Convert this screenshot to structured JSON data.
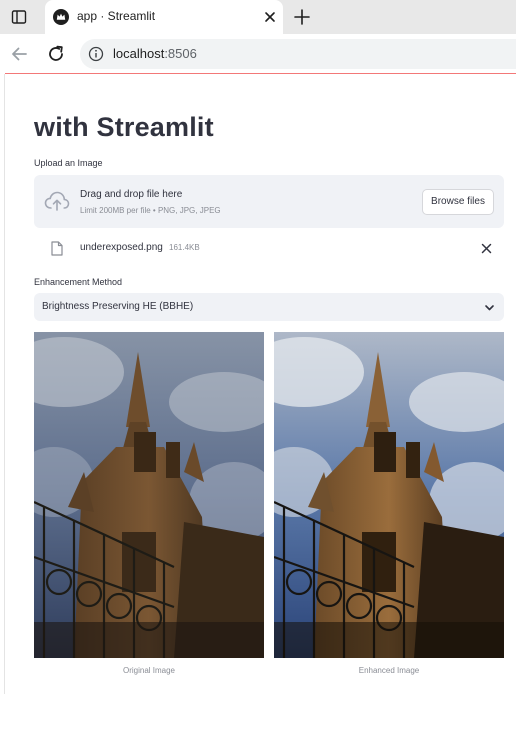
{
  "browser": {
    "tab_title": "app · Streamlit",
    "url_host": "localhost",
    "url_port": ":8506"
  },
  "app": {
    "title": "with Streamlit",
    "uploader": {
      "label": "Upload an Image",
      "dropzone_title": "Drag and drop file here",
      "dropzone_limit": "Limit 200MB per file • PNG, JPG, JPEG",
      "browse_label": "Browse files",
      "file_name": "underexposed.png",
      "file_size": "161.4KB"
    },
    "method": {
      "label": "Enhancement Method",
      "selected": "Brightness Preserving HE (BBHE)"
    },
    "images": {
      "original_caption": "Original Image",
      "enhanced_caption": "Enhanced Image"
    }
  },
  "icons": {
    "tab_panel": "sidebar-panel-icon",
    "favicon": "streamlit-crown-icon",
    "close": "close-icon",
    "new_tab": "plus-icon",
    "back": "arrow-left-icon",
    "reload": "reload-icon",
    "site_info": "info-icon",
    "upload": "cloud-upload-icon",
    "file": "file-icon",
    "remove": "close-icon",
    "chevron": "chevron-down-icon"
  },
  "colors": {
    "accent": "#ef4b4b",
    "widget_bg": "#f0f2f6",
    "text": "#31333f",
    "muted": "#8a8d95"
  }
}
